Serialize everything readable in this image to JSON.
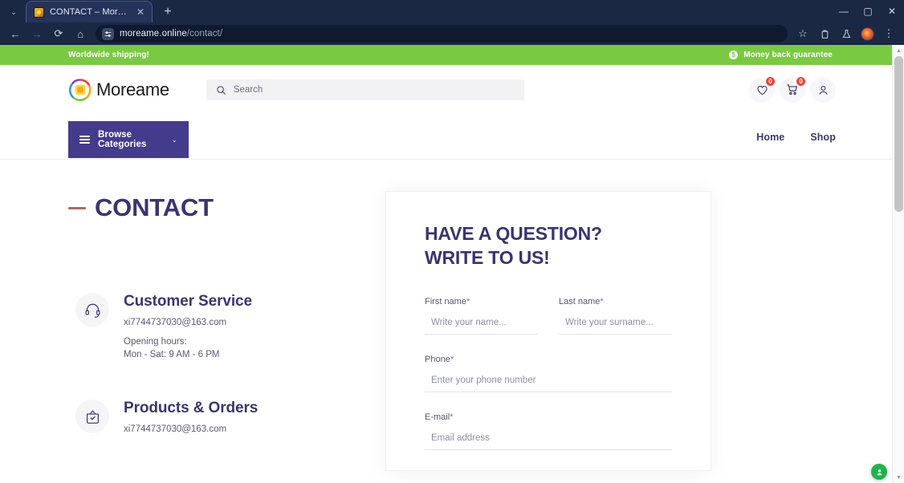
{
  "browser": {
    "tab": {
      "title": "CONTACT – Moreame",
      "close_label": "✕",
      "favicon_name": "moreame-favicon"
    },
    "new_tab_label": "+",
    "tab_list_label": "⌄",
    "window_controls": {
      "minimize": "—",
      "maximize": "▢",
      "close": "✕"
    },
    "nav": {
      "back": "←",
      "forward": "→",
      "reload": "⟳",
      "home": "⌂"
    },
    "omnibox": {
      "domain": "moreame.online",
      "path": "/contact/",
      "site_settings_label": "⚙"
    },
    "actions": {
      "bookmark": "☆",
      "extensions": "⬒",
      "labs": "⚗",
      "menu": "⋮",
      "profile": "profile-avatar"
    }
  },
  "announcement": {
    "left_text": "Worldwide shipping!",
    "right_text": "Money back guarantee",
    "coin_glyph": "$",
    "bg_color": "#7ac943"
  },
  "header": {
    "logo_text": "Moreame",
    "search": {
      "placeholder": "Search",
      "icon": "search-icon"
    },
    "wishlist": {
      "count": "0",
      "icon": "heart-icon"
    },
    "cart": {
      "count": "0",
      "icon": "cart-icon"
    },
    "account": {
      "icon": "user-icon"
    }
  },
  "nav": {
    "browse_label": "Browse Categories",
    "browse_chevron": "⌄",
    "links": [
      {
        "label": "Home"
      },
      {
        "label": "Shop"
      }
    ],
    "accent_color": "#453b8c"
  },
  "page": {
    "title": "CONTACT",
    "title_color": "#3b3470",
    "dash_color": "#a96a63"
  },
  "contact_blocks": [
    {
      "icon": "headset-icon",
      "title": "Customer Service",
      "email": "xi7744737030@163.com",
      "hours_label": "Opening hours:",
      "hours_value": "Mon - Sat: 9 AM - 6 PM"
    },
    {
      "icon": "shopping-bag-check-icon",
      "title": "Products & Orders",
      "email": "xi7744737030@163.com",
      "hours_label": "",
      "hours_value": ""
    }
  ],
  "form": {
    "heading_line1": "HAVE A QUESTION?",
    "heading_line2": "WRITE TO US!",
    "fields": [
      {
        "label": "First name",
        "required": "*",
        "placeholder": "Write your name...",
        "value": ""
      },
      {
        "label": "Last name",
        "required": "*",
        "placeholder": "Write your surname...",
        "value": ""
      },
      {
        "label": "Phone",
        "required": "*",
        "placeholder": "Enter your phone number",
        "value": ""
      },
      {
        "label": "E-mail",
        "required": "*",
        "placeholder": "Email address",
        "value": ""
      }
    ]
  },
  "float_button": {
    "icon": "location-person-icon",
    "color": "#22b14c"
  }
}
